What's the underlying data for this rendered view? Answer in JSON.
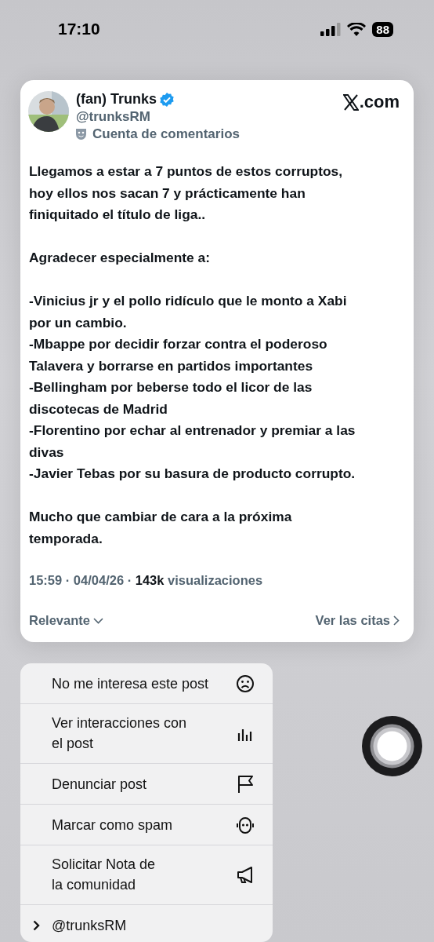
{
  "status_bar": {
    "time": "17:10",
    "battery": "88"
  },
  "post": {
    "author": {
      "name": "(fan) Trunks",
      "verified": true,
      "handle": "@trunksRM",
      "label": "Cuenta de comentarios"
    },
    "site": ".com",
    "paragraphs": [
      "Llegamos a estar a 7 puntos de estos corruptos,\nhoy ellos nos sacan 7 y prácticamente han\nfiniquitado el título de liga..",
      "Agradecer especialmente a:",
      "-Vinicius jr y el pollo ridículo que le monto a Xabi\npor un cambio.\n-Mbappe por decidir forzar contra el poderoso\nTalavera y borrarse en partidos importantes\n-Bellingham por beberse todo el licor de las\ndiscotecas de Madrid\n-Florentino por echar al entrenador y premiar a las\ndivas\n-Javier Tebas por su basura de producto corrupto.",
      "Mucho que cambiar de cara a la próxima\ntemporada."
    ],
    "meta": "15:59 · 04/04/26 · **143k** visualizaciones",
    "sort": "Relevante",
    "quotes": "Ver las citas"
  },
  "menu": [
    {
      "kind": "action",
      "label": "No me interesa este post"
    },
    {
      "kind": "action",
      "label": "Ver interacciones con\nel post"
    },
    {
      "kind": "action",
      "label": "Denunciar post"
    },
    {
      "kind": "action",
      "label": "Marcar como spam"
    },
    {
      "kind": "action",
      "label": "Solicitar Nota de\nla comunidad"
    },
    {
      "kind": "submenu",
      "label": "@trunksRM"
    }
  ]
}
